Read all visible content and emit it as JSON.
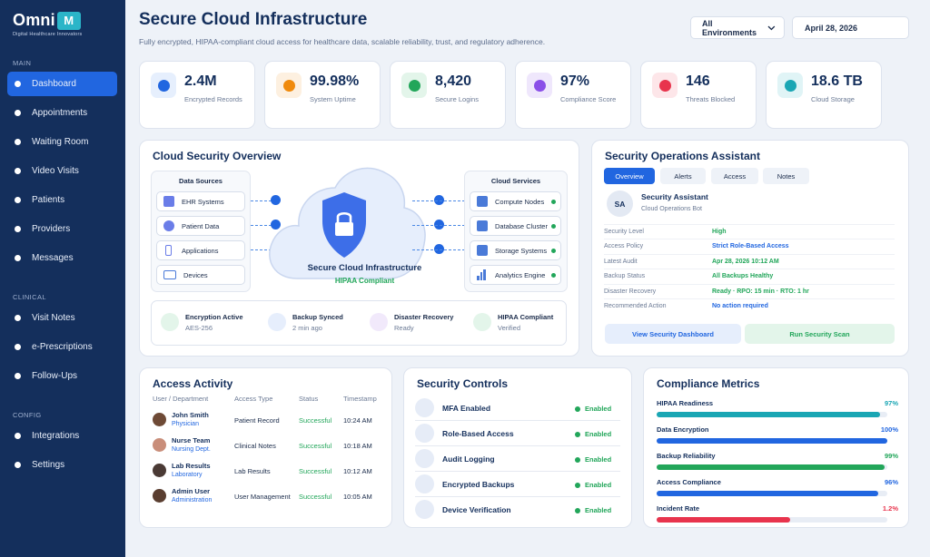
{
  "app": {
    "logo_text": "Omni",
    "logo_mark": "M",
    "logo_sub": "Digital Healthcare Innovators"
  },
  "sidebar": {
    "sections": [
      {
        "label": "MAIN",
        "items": [
          "Dashboard",
          "Appointments",
          "Waiting Room",
          "Video Visits",
          "Patients",
          "Providers",
          "Messages"
        ]
      },
      {
        "label": "CLINICAL",
        "items": [
          "Visit Notes",
          "e-Prescriptions",
          "Follow-Ups"
        ]
      },
      {
        "label": "CONFIG",
        "items": [
          "Integrations",
          "Settings"
        ]
      }
    ],
    "active": "Dashboard"
  },
  "header": {
    "title": "Secure Cloud Infrastructure",
    "subtitle": "Fully encrypted, HIPAA-compliant cloud access for healthcare data, scalable reliability, trust, and regulatory adherence.",
    "env_select": "All Environments",
    "date": "April 28, 2026"
  },
  "kpis": [
    {
      "value": "2.4M",
      "label": "Encrypted Records",
      "color": "#2166e0",
      "bg": "#e6effd"
    },
    {
      "value": "99.98%",
      "label": "System Uptime",
      "color": "#f08a0c",
      "bg": "#fdf0e0"
    },
    {
      "value": "8,420",
      "label": "Secure Logins",
      "color": "#22a65a",
      "bg": "#e3f5ea"
    },
    {
      "value": "97%",
      "label": "Compliance Score",
      "color": "#8a4ee8",
      "bg": "#efe7fc"
    },
    {
      "value": "146",
      "label": "Threats Blocked",
      "color": "#e8344d",
      "bg": "#fde6e9"
    },
    {
      "value": "18.6 TB",
      "label": "Cloud Storage",
      "color": "#1aa6b4",
      "bg": "#e0f4f6"
    }
  ],
  "overview": {
    "title": "Cloud Security Overview",
    "sources_title": "Data Sources",
    "sources": [
      "EHR Systems",
      "Patient Data",
      "Applications",
      "Devices"
    ],
    "services_title": "Cloud Services",
    "services": [
      "Compute Nodes",
      "Database Cluster",
      "Storage Systems",
      "Analytics Engine"
    ],
    "center_title": "Secure Cloud Infrastructure",
    "center_sub": "HIPAA Compliant",
    "status": [
      {
        "title": "Encryption Active",
        "sub": "AES-256",
        "color": "#e3f5ea"
      },
      {
        "title": "Backup Synced",
        "sub": "2 min ago",
        "color": "#e6eefc"
      },
      {
        "title": "Disaster Recovery",
        "sub": "Ready",
        "color": "#f1e9fb"
      },
      {
        "title": "HIPAA Compliant",
        "sub": "Verified",
        "color": "#e3f5ea"
      }
    ]
  },
  "assistant": {
    "title": "Security Operations Assistant",
    "tabs": [
      "Overview",
      "Alerts",
      "Access",
      "Notes"
    ],
    "active_tab": "Overview",
    "avatar": "SA",
    "name": "Security Assistant",
    "role": "Cloud Operations Bot",
    "rows": [
      {
        "k": "Security Level",
        "v": "High",
        "color": "#22a65a"
      },
      {
        "k": "Access Policy",
        "v": "Strict Role-Based Access",
        "color": "#2166e0"
      },
      {
        "k": "Latest Audit",
        "v": "Apr 28, 2026 10:12 AM",
        "color": "#22a65a"
      },
      {
        "k": "Backup Status",
        "v": "All Backups Healthy",
        "color": "#22a65a"
      },
      {
        "k": "Disaster Recovery",
        "v": "Ready · RPO: 15 min · RTO: 1 hr",
        "color": "#22a65a"
      },
      {
        "k": "Recommended Action",
        "v": "No action required",
        "color": "#2166e0"
      }
    ],
    "btn_dashboard": "View Security Dashboard",
    "btn_scan": "Run Security Scan"
  },
  "access": {
    "title": "Access Activity",
    "headers": [
      "User / Department",
      "Access Type",
      "Status",
      "Timestamp"
    ],
    "rows": [
      {
        "name": "John Smith",
        "dept": "Physician",
        "type": "Patient Record",
        "status": "Successful",
        "time": "10:24 AM"
      },
      {
        "name": "Nurse Team",
        "dept": "Nursing Dept.",
        "type": "Clinical Notes",
        "status": "Successful",
        "time": "10:18 AM"
      },
      {
        "name": "Lab Results",
        "dept": "Laboratory",
        "type": "Lab Results",
        "status": "Successful",
        "time": "10:12 AM"
      },
      {
        "name": "Admin User",
        "dept": "Administration",
        "type": "User Management",
        "status": "Successful",
        "time": "10:05 AM"
      }
    ]
  },
  "controls": {
    "title": "Security Controls",
    "items": [
      {
        "name": "MFA Enabled",
        "status": "Enabled"
      },
      {
        "name": "Role-Based Access",
        "status": "Enabled"
      },
      {
        "name": "Audit Logging",
        "status": "Enabled"
      },
      {
        "name": "Encrypted Backups",
        "status": "Enabled"
      },
      {
        "name": "Device Verification",
        "status": "Enabled"
      }
    ]
  },
  "compliance": {
    "title": "Compliance Metrics",
    "items": [
      {
        "name": "HIPAA Readiness",
        "value": "97%",
        "fraction": 0.97,
        "color": "#1aa6b4"
      },
      {
        "name": "Data Encryption",
        "value": "100%",
        "fraction": 1.0,
        "color": "#2166e0"
      },
      {
        "name": "Backup Reliability",
        "value": "99%",
        "fraction": 0.99,
        "color": "#22a65a"
      },
      {
        "name": "Access Compliance",
        "value": "96%",
        "fraction": 0.96,
        "color": "#2166e0"
      },
      {
        "name": "Incident Rate",
        "value": "1.2%",
        "fraction": 0.58,
        "color": "#e8344d"
      }
    ]
  }
}
